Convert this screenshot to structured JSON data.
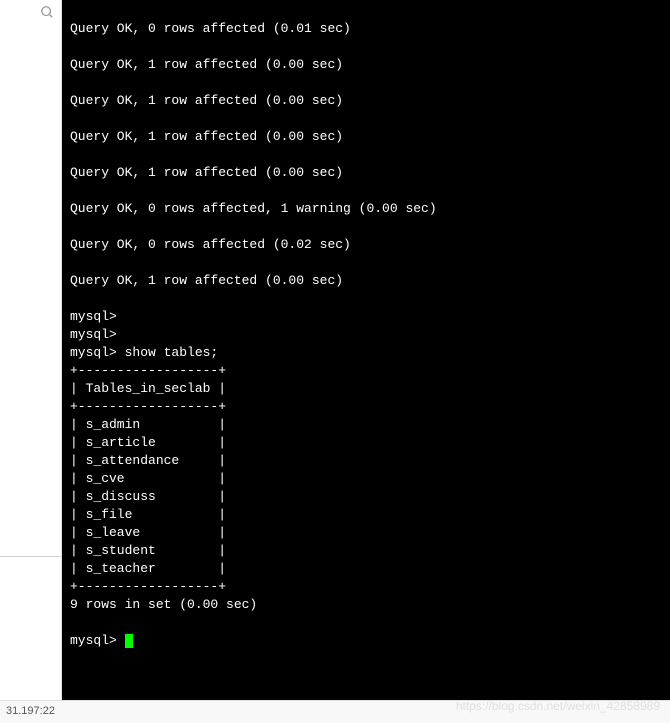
{
  "terminal": {
    "lines": [
      "",
      "Query OK, 0 rows affected (0.01 sec)",
      "",
      "Query OK, 1 row affected (0.00 sec)",
      "",
      "Query OK, 1 row affected (0.00 sec)",
      "",
      "Query OK, 1 row affected (0.00 sec)",
      "",
      "Query OK, 1 row affected (0.00 sec)",
      "",
      "Query OK, 0 rows affected, 1 warning (0.00 sec)",
      "",
      "Query OK, 0 rows affected (0.02 sec)",
      "",
      "Query OK, 1 row affected (0.00 sec)",
      "",
      "mysql>",
      "mysql>",
      "mysql> show tables;",
      "+------------------+",
      "| Tables_in_seclab |",
      "+------------------+",
      "| s_admin          |",
      "| s_article        |",
      "| s_attendance     |",
      "| s_cve            |",
      "| s_discuss        |",
      "| s_file           |",
      "| s_leave          |",
      "| s_student        |",
      "| s_teacher        |",
      "+------------------+",
      "9 rows in set (0.00 sec)",
      "",
      "mysql> "
    ],
    "prompt": "mysql> "
  },
  "status": {
    "text": "31.197:22"
  },
  "watermark": {
    "text": "https://blog.csdn.net/weixin_42858989"
  }
}
